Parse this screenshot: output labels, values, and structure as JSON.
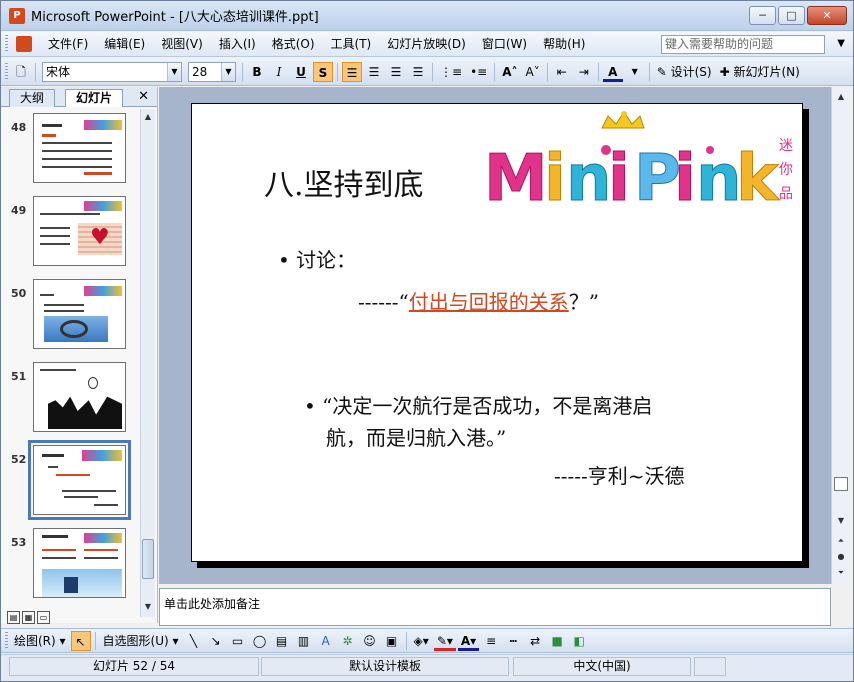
{
  "window": {
    "title": "Microsoft PowerPoint - [八大心态培训课件.ppt]",
    "min_label": "─",
    "max_label": "□",
    "close_label": "✕"
  },
  "menubar": {
    "items": [
      "文件(F)",
      "编辑(E)",
      "视图(V)",
      "插入(I)",
      "格式(O)",
      "工具(T)",
      "幻灯片放映(D)",
      "窗口(W)",
      "帮助(H)"
    ],
    "help_placeholder": "键入需要帮助的问题"
  },
  "toolbar": {
    "font": "宋体",
    "size": "28",
    "bold": "B",
    "italic": "I",
    "underline": "U",
    "shadow": "S",
    "design_label": "设计(S)",
    "new_slide_label": "新幻灯片(N)"
  },
  "pane_tabs": {
    "outline": "大纲",
    "slides": "幻灯片",
    "close": "✕"
  },
  "thumbnails": [
    {
      "number": "48"
    },
    {
      "number": "49"
    },
    {
      "number": "50"
    },
    {
      "number": "51"
    },
    {
      "number": "52",
      "current": true
    },
    {
      "number": "53"
    }
  ],
  "slide": {
    "title": "八.坚持到底",
    "bullet1": "讨论：",
    "sub_prefix": "------“",
    "sub_link": "付出与回报的关系",
    "sub_suffix": "？”",
    "quote_line1": "“决定一次航行是否成功，不是离港启",
    "quote_line2": "航，而是归航入港。”",
    "attribution": "-----亨利~沃德",
    "logo_text": "MiniPink",
    "logo_side": "迷你品"
  },
  "notes": {
    "placeholder": "单击此处添加备注"
  },
  "drawing_toolbar": {
    "draw_label": "绘图(R)",
    "autoshape_label": "自选图形(U)"
  },
  "statusbar": {
    "slide_indicator": "幻灯片 52 / 54",
    "template": "默认设计模板",
    "language": "中文(中国)"
  },
  "colors": {
    "accent_link": "#d2481f",
    "selection": "#4a79b6"
  }
}
